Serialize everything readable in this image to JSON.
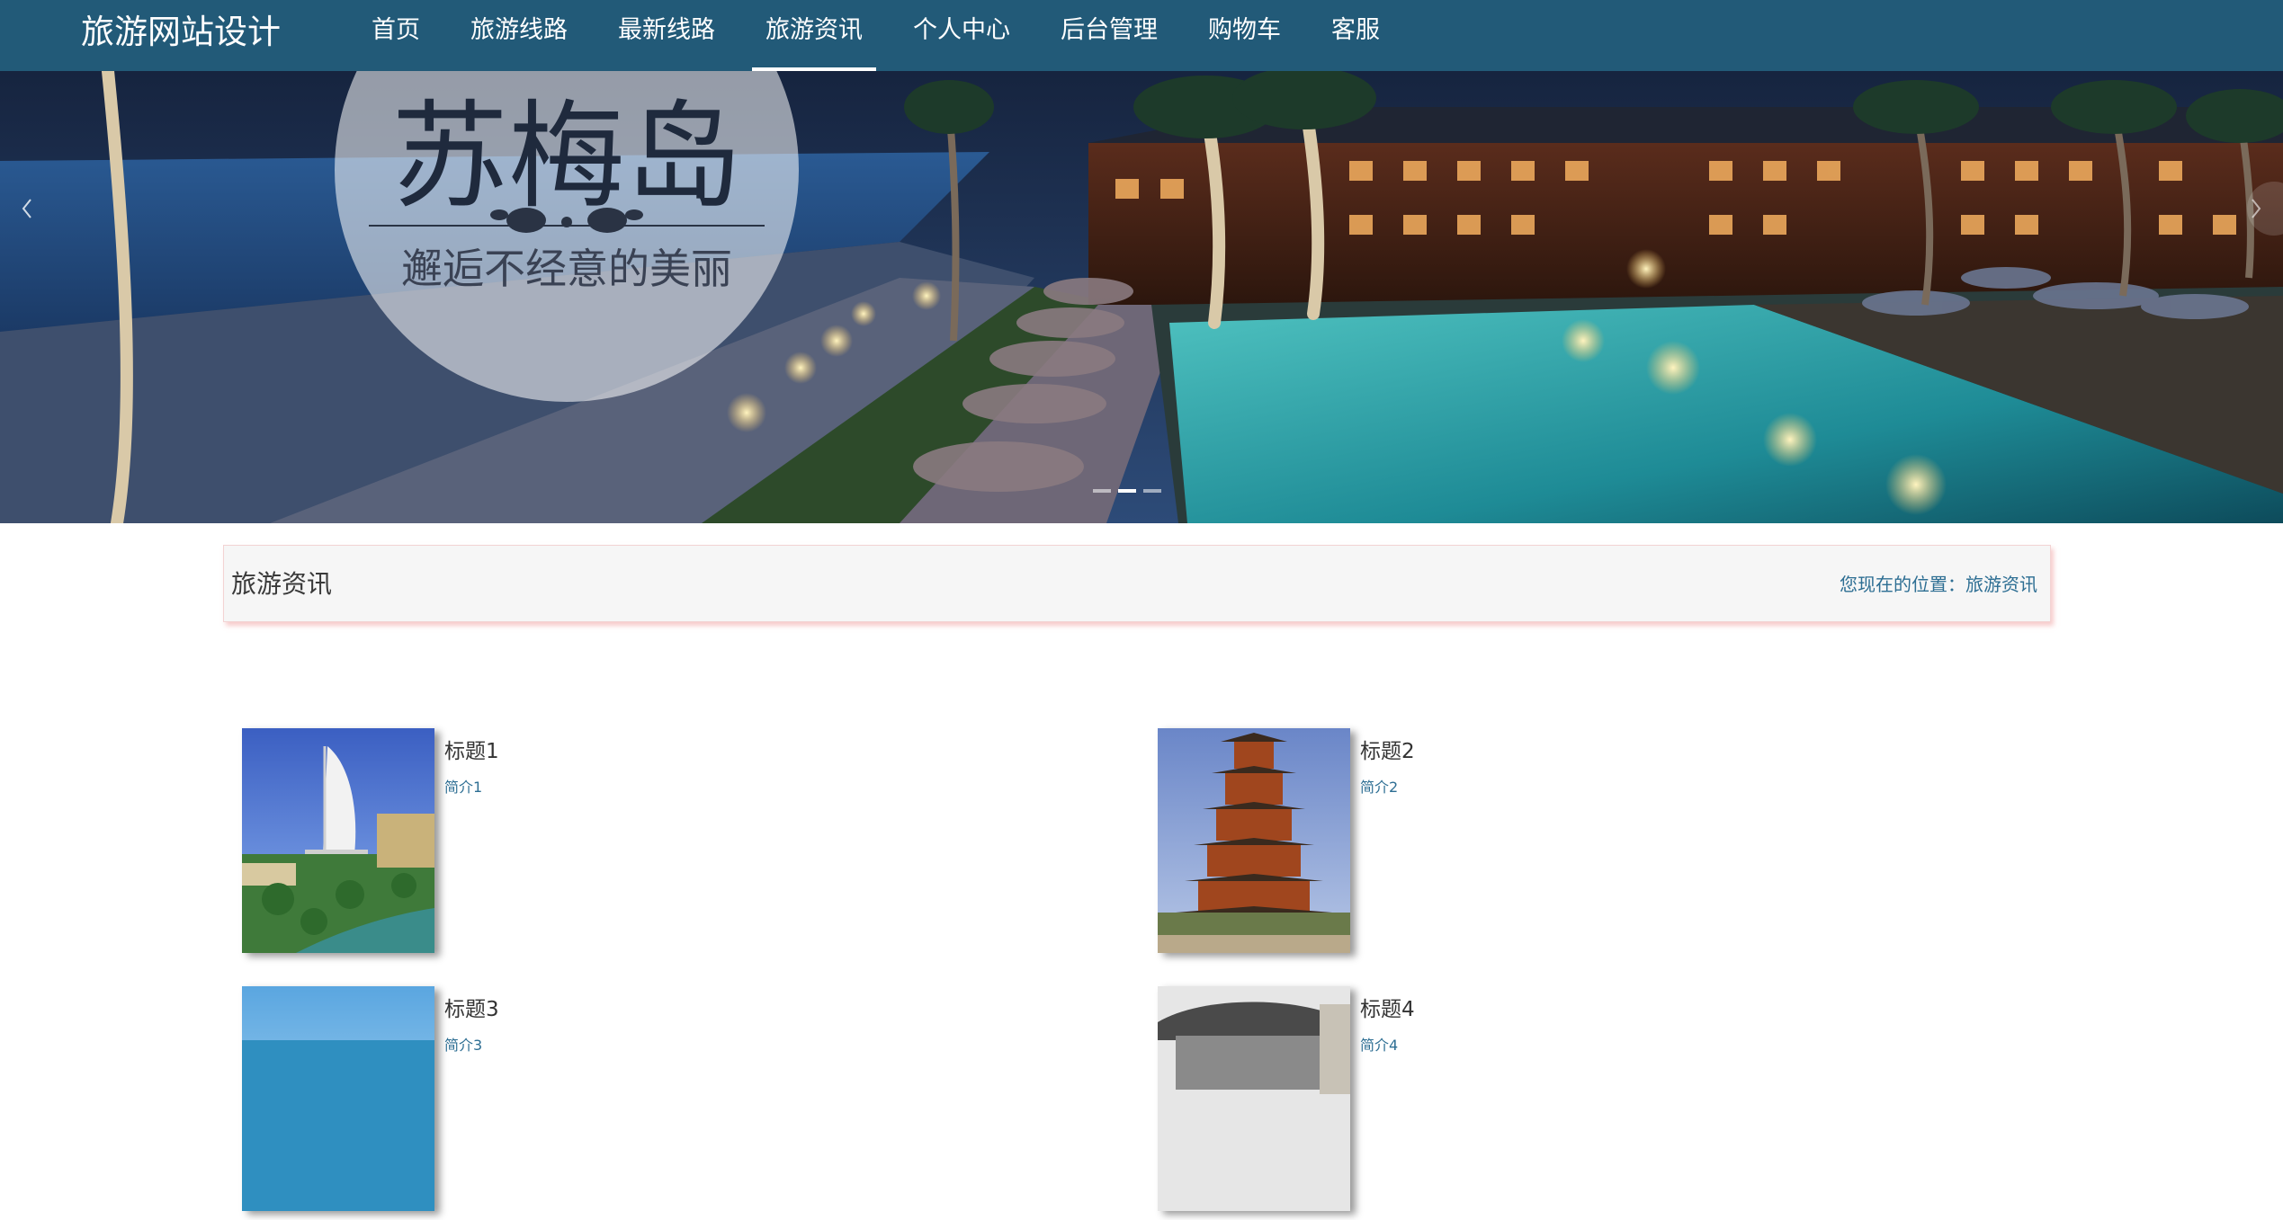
{
  "header": {
    "brand": "旅游网站设计",
    "nav": [
      {
        "label": "首页",
        "active": false
      },
      {
        "label": "旅游线路",
        "active": false
      },
      {
        "label": "最新线路",
        "active": false
      },
      {
        "label": "旅游资讯",
        "active": true
      },
      {
        "label": "个人中心",
        "active": false
      },
      {
        "label": "后台管理",
        "active": false
      },
      {
        "label": "购物车",
        "active": false
      },
      {
        "label": "客服",
        "active": false
      }
    ]
  },
  "banner": {
    "title": "苏梅岛",
    "subtitle": "邂逅不经意的美丽",
    "prev_icon": "chevron-left-icon",
    "next_icon": "chevron-right-icon",
    "slide_count": 3,
    "active_slide": 2
  },
  "breadcrumb": {
    "title": "旅游资讯",
    "location_label": "您现在的位置：",
    "current": "旅游资讯"
  },
  "news": [
    {
      "title": "标题1",
      "intro": "简介1"
    },
    {
      "title": "标题2",
      "intro": "简介2"
    },
    {
      "title": "标题3",
      "intro": "简介3"
    },
    {
      "title": "标题4",
      "intro": "简介4"
    }
  ],
  "colors": {
    "navbar": "#225a78",
    "link": "#2d6e93",
    "breadcrumb_bg": "#f6f6f6",
    "breadcrumb_shadow": "#f0a0a0"
  }
}
